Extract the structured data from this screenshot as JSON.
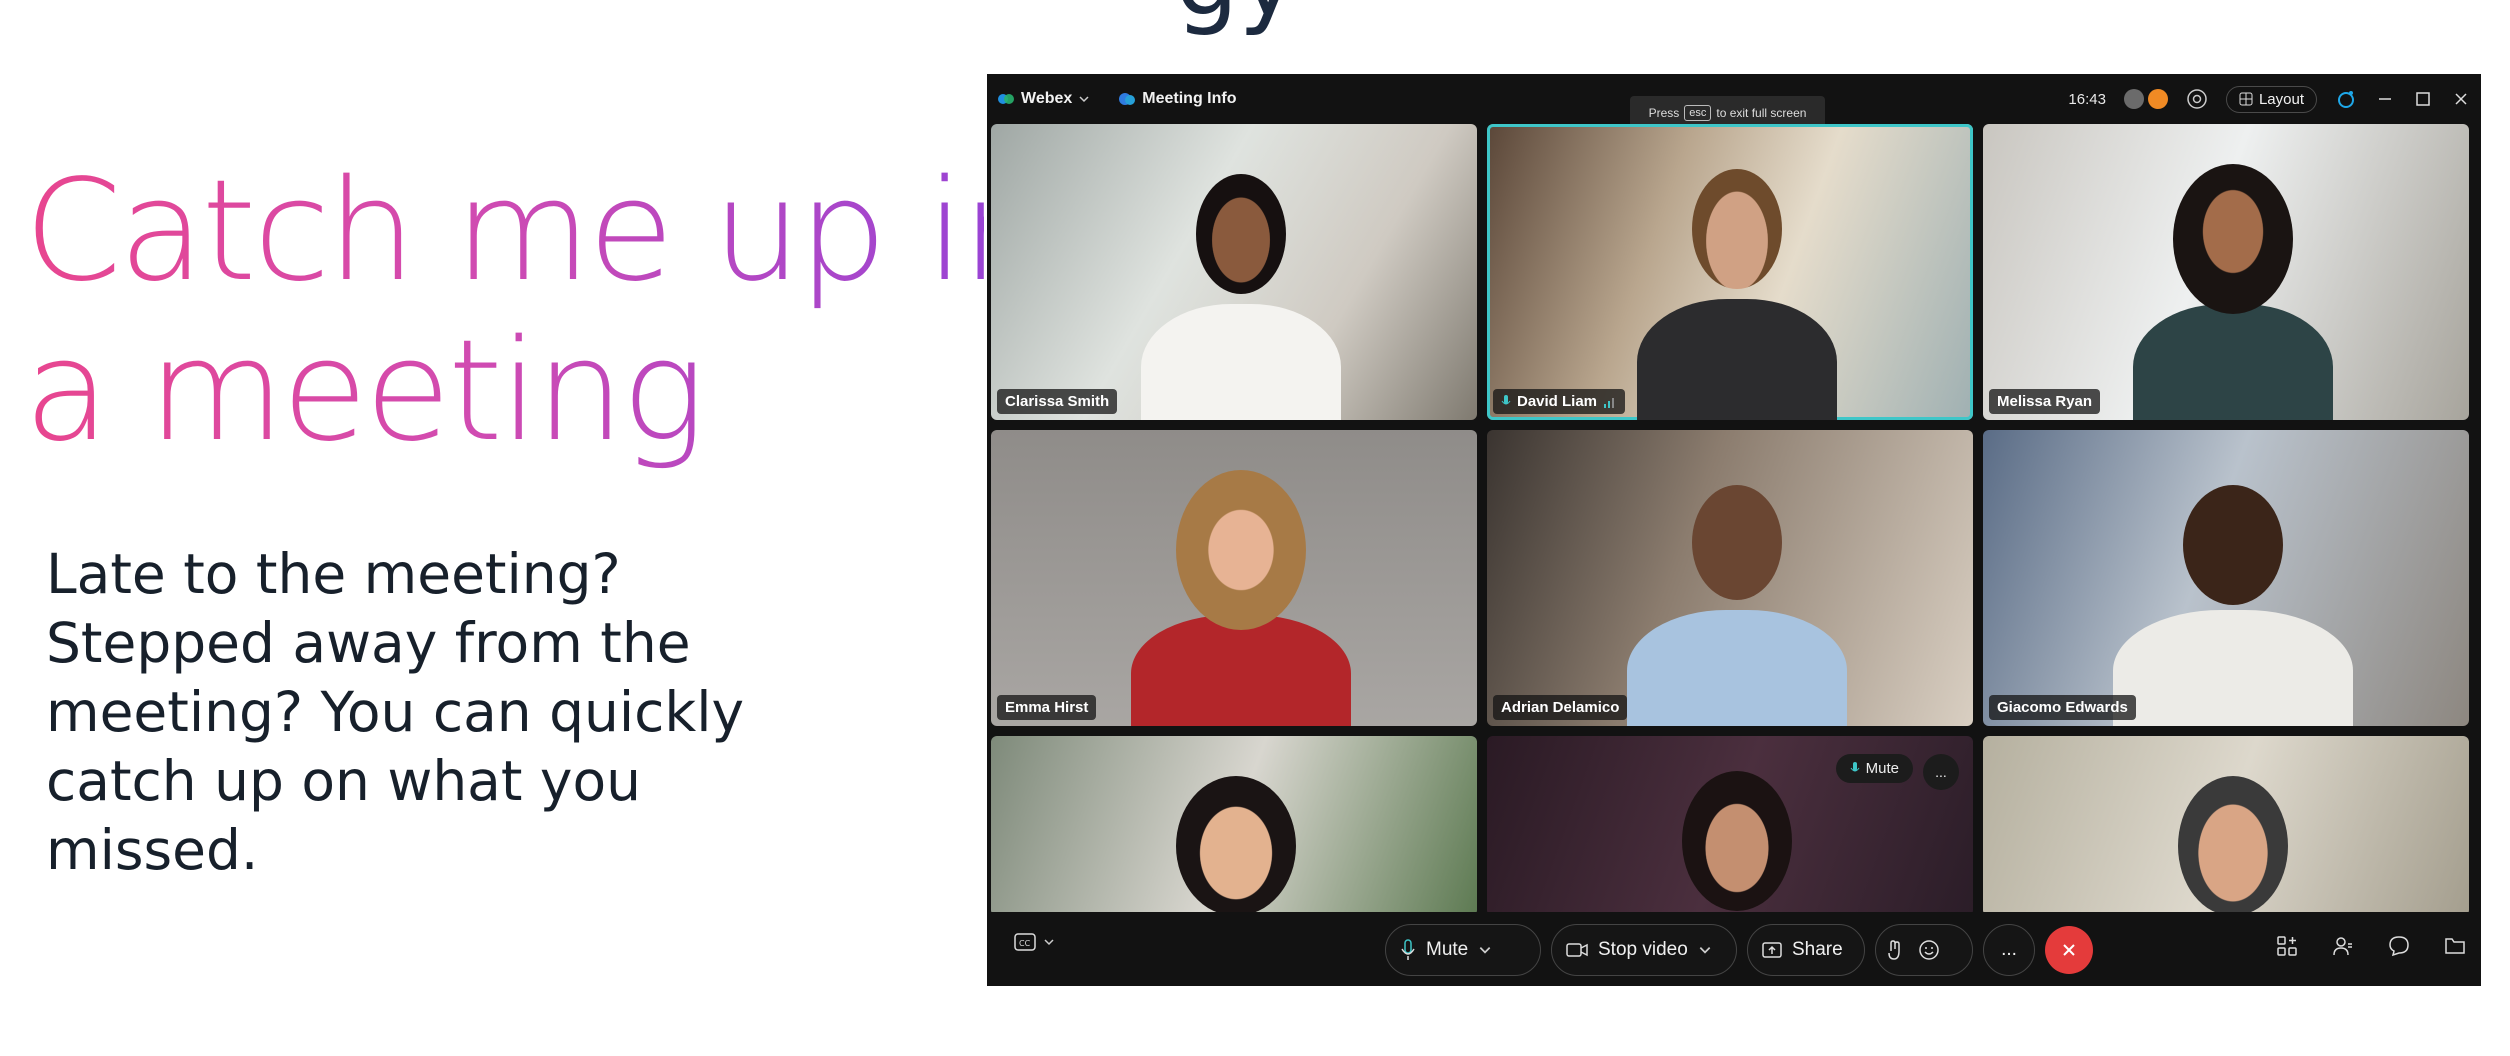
{
  "slide": {
    "title_line1": "Catch me up in",
    "title_line2": "a meeting",
    "body": "Late to the meeting? Stepped away from the meeting? You can quickly catch up on what you missed.",
    "top_fragment": "gy"
  },
  "app": {
    "brand": "Webex",
    "meeting_info_label": "Meeting Info",
    "time": "16:43",
    "layout_label": "Layout",
    "fullscreen_tip_prefix": "Press",
    "fullscreen_tip_key": "esc",
    "fullscreen_tip_suffix": "to exit full screen"
  },
  "participants": [
    {
      "name": "Clarissa Smith"
    },
    {
      "name": "David Liam"
    },
    {
      "name": "Melissa Ryan"
    },
    {
      "name": "Emma Hirst"
    },
    {
      "name": "Adrian Delamico"
    },
    {
      "name": "Giacomo Edwards"
    },
    {
      "name": ""
    },
    {
      "name": ""
    },
    {
      "name": ""
    }
  ],
  "tile_overlay": {
    "mute_label": "Mute",
    "more_label": "..."
  },
  "controls": {
    "mute_label": "Mute",
    "stop_video_label": "Stop video",
    "share_label": "Share",
    "more_label": "..."
  },
  "colors": {
    "active_speaker_border": "#3ec6c8",
    "end_call": "#e43b3b",
    "title_gradient_start": "#e8468f",
    "title_gradient_end": "#9a44d4"
  }
}
